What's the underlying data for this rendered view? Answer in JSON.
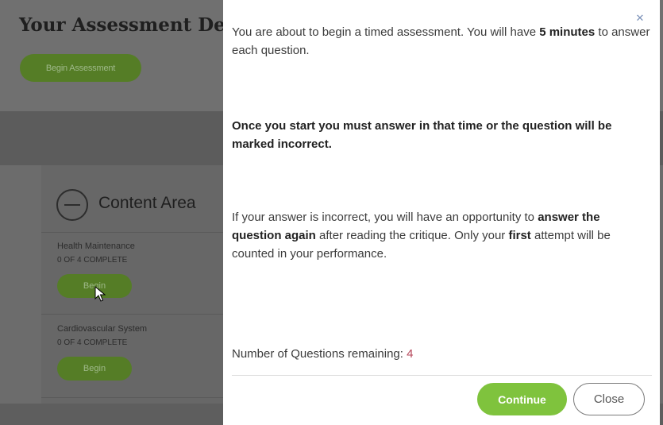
{
  "background": {
    "page_title": "Your Assessment De",
    "begin_assessment_label": "Begin Assessment",
    "content_area_label": "Content Area",
    "items": [
      {
        "title": "Health Maintenance",
        "status": "0 OF 4 COMPLETE",
        "button": "Begin"
      },
      {
        "title": "Cardiovascular System",
        "status": "0 OF 4 COMPLETE",
        "button": "Begin"
      }
    ]
  },
  "modal": {
    "close_icon": "close-icon",
    "p1": {
      "a": "You are about to begin a timed assessment. You will have ",
      "b": "5 minutes",
      "c": " to answer each question."
    },
    "p2": "Once you start you must answer in that time or the question will be marked incorrect.",
    "p3": {
      "a": "If your answer is incorrect, you will have an opportunity to ",
      "b": "answer the question again",
      "c": " after reading the critique. Only your ",
      "d": "first",
      "e": " attempt will be counted in your performance."
    },
    "remaining_label": "Number of Questions remaining: ",
    "remaining_count": "4",
    "continue_label": "Continue",
    "close_label": "Close"
  },
  "colors": {
    "accent_green": "#7fc33d",
    "count_red": "#b5465a",
    "overlay_gray": "#6c6c6c"
  }
}
